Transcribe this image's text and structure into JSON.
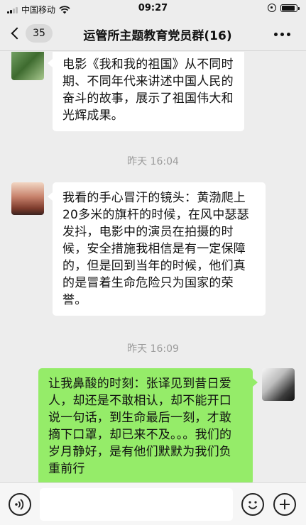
{
  "status_bar": {
    "carrier": "中国移动",
    "time": "09:27"
  },
  "header": {
    "back_icon": "chevron-left-icon",
    "unread_count": "35",
    "title": "运管所主题教育党员群(16)",
    "more_icon": "more-dots-icon"
  },
  "messages": [
    {
      "side": "left",
      "text": "电影《我和我的祖国》从不同时期、不同年代来讲述中国人民的奋斗的故事，展示了祖国伟大和光辉成果。"
    },
    {
      "type": "timestamp",
      "text": "昨天 16:04"
    },
    {
      "side": "left",
      "text": "我看的手心冒汗的镜头：黄渤爬上20多米的旗杆的时候，在风中瑟瑟发抖，电影中的演员在拍摄的时候，安全措施我相信是有一定保障的，但是回到当年的时候，他们真的是冒着生命危险只为国家的荣誉。"
    },
    {
      "type": "timestamp",
      "text": "昨天 16:09"
    },
    {
      "side": "right",
      "text": "让我鼻酸的时刻：张译见到昔日爱人，却还是不敢相认，却不能开口说一句话，到生命最后一刻，才敢摘下口罩，却已来不及。。。我们的岁月静好，是有他们默默为我们负重前行"
    }
  ],
  "input_bar": {
    "voice_icon": "voice-icon",
    "emoji_icon": "emoji-icon",
    "plus_icon": "plus-icon"
  },
  "colors": {
    "background": "#ededed",
    "own_bubble": "#95ec69",
    "other_bubble": "#ffffff",
    "timestamp": "#9b9b9b"
  }
}
